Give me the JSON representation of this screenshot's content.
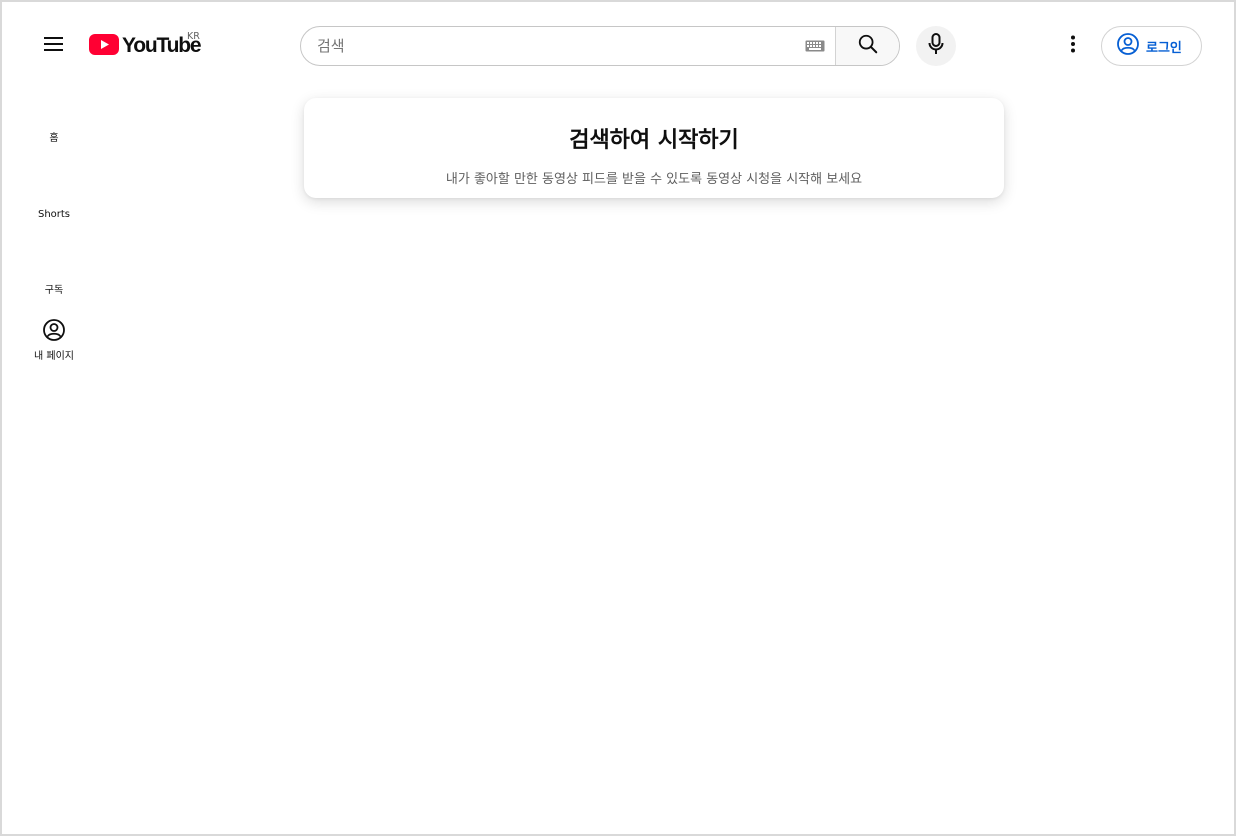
{
  "header": {
    "logo_text": "YouTube",
    "country_code": "KR",
    "search_placeholder": "검색",
    "signin_label": "로그인"
  },
  "sidebar": {
    "items": [
      {
        "label": "홈",
        "icon": "home-icon"
      },
      {
        "label": "Shorts",
        "icon": "shorts-icon"
      },
      {
        "label": "구독",
        "icon": "subscriptions-icon"
      },
      {
        "label": "내 페이지",
        "icon": "account-circle-icon"
      }
    ]
  },
  "main": {
    "card_title": "검색하여 시작하기",
    "card_subtitle": "내가 좋아할 만한 동영상 피드를 받을 수 있도록 동영상 시청을 시작해 보세요"
  },
  "colors": {
    "brand_red": "#ff0033",
    "link_blue": "#065fd4",
    "text_primary": "#0f0f0f",
    "text_secondary": "#606060"
  }
}
